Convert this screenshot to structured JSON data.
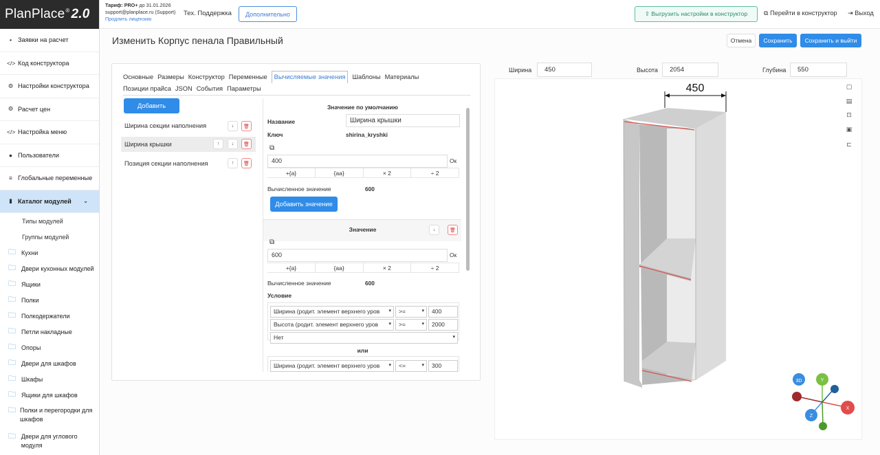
{
  "app": {
    "logo_name": "PlanPlace",
    "logo_mark": "®",
    "logo_version": "2.0"
  },
  "sidebar": {
    "items": [
      {
        "label": "Заявки на расчет",
        "icon": "document-icon",
        "glyph": "▪"
      },
      {
        "label": "Код конструктора",
        "icon": "code-icon",
        "glyph": "</>"
      },
      {
        "label": "Настройки конструктора",
        "icon": "gears-icon",
        "glyph": "⚙"
      },
      {
        "label": "Расчет цен",
        "icon": "gears-icon",
        "glyph": "⚙"
      },
      {
        "label": "Настройка меню",
        "icon": "code-icon",
        "glyph": "</>"
      },
      {
        "label": "Пользователи",
        "icon": "user-icon",
        "glyph": "●"
      },
      {
        "label": "Глобальные переменные",
        "icon": "list-icon",
        "glyph": "≡"
      },
      {
        "label": "Каталог модулей",
        "icon": "book-icon",
        "glyph": "▮"
      }
    ],
    "sub_items": [
      "Типы модулей",
      "Группы модулей"
    ],
    "folders": [
      "Кухни",
      "Двери кухонных модулей",
      "Ящики",
      "Полки",
      "Полкодержатели",
      "Петли накладные",
      "Опоры",
      "Двери для шкафов",
      "Шкафы",
      "Ящики для шкафов",
      "Полки и перегородки для шкафов",
      "Двери для углового модуля"
    ]
  },
  "topbar": {
    "tariff_label": "Тариф: PRO+",
    "tariff_until": "до 31.01.2026",
    "support_email": "support@planplace.ru (Support)",
    "renew_link": "Продлить лицензию",
    "support": "Тех. Поддержка",
    "more_button": "Дополнительно",
    "export_button": "⇪ Выгрузить настройки в конструктор",
    "goto_constructor": "Перейти в конструктор",
    "exit": "Выход"
  },
  "page": {
    "title": "Изменить Корпус пенала Правильный",
    "cancel": "Отмена",
    "save": "Сохранить",
    "save_exit": "Сохранить и выйти"
  },
  "tabs": [
    "Основные",
    "Размеры",
    "Конструктор",
    "Переменные",
    "Вычисляемые значения",
    "Шаблоны",
    "Материалы",
    "Позиции прайса",
    "JSON",
    "События",
    "Параметры"
  ],
  "left_list": {
    "add_button": "Добавить",
    "items": [
      "Ширина секции наполнения",
      "Ширина крышки",
      "Позиция секции наполнения"
    ]
  },
  "form": {
    "default_title": "Значение по умолчанию",
    "name_label": "Название",
    "name_value": "Ширина крышки",
    "key_label": "Ключ",
    "key_value": "shirina_kryshki",
    "default_value": "400",
    "ok": "Ок",
    "ops": [
      "+{a}",
      "{aa}",
      "× 2",
      "÷ 2"
    ],
    "computed_label": "Вычисленное значение",
    "computed_default": "600",
    "add_value": "Добавить значение",
    "value_title": "Значение",
    "value_input": "600",
    "computed_value": "600",
    "condition_label": "Условие",
    "cond1": [
      {
        "field": "Ширина (родит. элемент верхнего уров",
        "op": ">=",
        "val": "400"
      },
      {
        "field": "Высота (родит. элемент верхнего уров",
        "op": ">=",
        "val": "2000"
      }
    ],
    "cond1_extra": "Нет",
    "or_label": "или",
    "cond2": [
      {
        "field": "Ширина (родит. элемент верхнего уров",
        "op": "<=",
        "val": "300"
      }
    ]
  },
  "dimensions": {
    "width_label": "Ширина",
    "width": "450",
    "height_label": "Высота",
    "height": "2054",
    "depth_label": "Глубина",
    "depth": "550"
  },
  "viewer": {
    "dim_text": "450",
    "axis_3d": "3D",
    "axis_y": "Y",
    "axis_x": "X",
    "axis_z": "Z"
  }
}
